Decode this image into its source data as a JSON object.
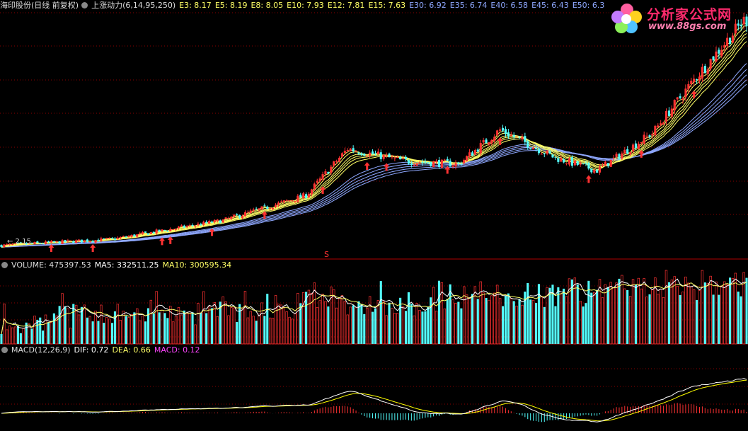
{
  "price_header": {
    "stock": "海印股份(日线 前复权)",
    "indicator": "上涨动力(6,14,95,250)",
    "values": [
      {
        "label": "E3: 8.17",
        "color": "#ffff66"
      },
      {
        "label": "E5: 8.19",
        "color": "#ffff66"
      },
      {
        "label": "E8: 8.05",
        "color": "#ffff66"
      },
      {
        "label": "E10: 7.93",
        "color": "#ffff66"
      },
      {
        "label": "E12: 7.81",
        "color": "#ffff66"
      },
      {
        "label": "E15: 7.63",
        "color": "#ffff66"
      },
      {
        "label": "E30: 6.92",
        "color": "#8fa8ff"
      },
      {
        "label": "E35: 6.74",
        "color": "#8fa8ff"
      },
      {
        "label": "E40: 6.58",
        "color": "#8fa8ff"
      },
      {
        "label": "E45: 6.43",
        "color": "#8fa8ff"
      },
      {
        "label": "E50: 6.3",
        "color": "#8fa8ff"
      }
    ]
  },
  "low_label": "← 2.15",
  "s_marker": "S",
  "volume_header": {
    "label": "VOLUME: 475397.53",
    "ma5": "MA5: 332511.25",
    "ma10": "MA10: 300595.34"
  },
  "macd_header": {
    "label": "MACD(12,26,9)",
    "dif": "DIF: 0.72",
    "dea": "DEA: 0.66",
    "macd": "MACD: 0.12"
  },
  "watermark": {
    "title": "分析家公式网",
    "url": "www.88gs.com"
  },
  "colors": {
    "up": "#ff3232",
    "down": "#54ffff",
    "grid": "#8a0000",
    "ema_short": "#ffff66",
    "ema_long": "#8fa8ff",
    "dif": "#ffffff",
    "dea": "#ffff00",
    "macd_label": "#ff44ff"
  },
  "chart_data": {
    "type": "candlestick",
    "key_price_points": [
      {
        "bar": 0,
        "price": 2.2
      },
      {
        "bar": 40,
        "price": 2.4
      },
      {
        "bar": 80,
        "price": 3.0
      },
      {
        "bar": 110,
        "price": 3.8
      },
      {
        "bar": 125,
        "price": 5.3
      },
      {
        "bar": 145,
        "price": 4.9
      },
      {
        "bar": 165,
        "price": 4.8
      },
      {
        "bar": 180,
        "price": 5.9
      },
      {
        "bar": 200,
        "price": 5.0
      },
      {
        "bar": 215,
        "price": 4.6
      },
      {
        "bar": 235,
        "price": 5.8
      },
      {
        "bar": 250,
        "price": 7.5
      },
      {
        "bar": 268,
        "price": 9.4
      }
    ],
    "buy_signal_bars": [
      18,
      33,
      58,
      61,
      76,
      95,
      116,
      132,
      139,
      161,
      180,
      212,
      231,
      250
    ],
    "low_marker_price": 2.15
  }
}
